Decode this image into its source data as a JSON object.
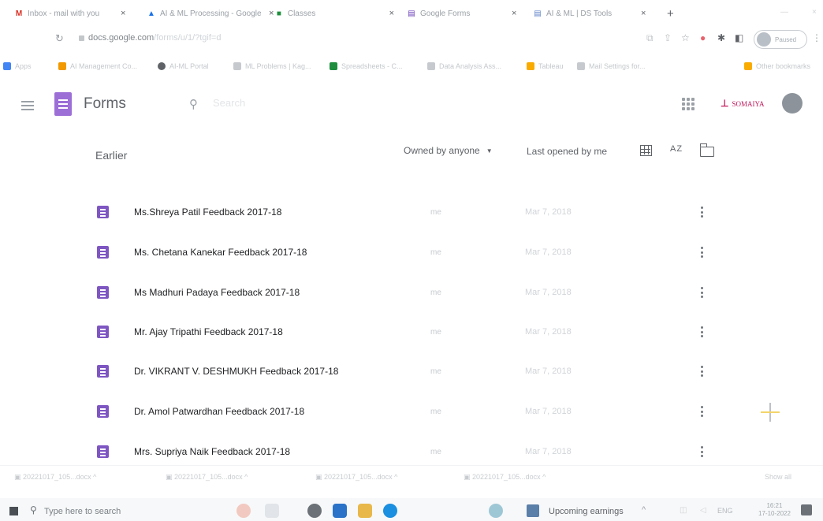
{
  "browser": {
    "tabs": [
      {
        "title": "Inbox - mail with you",
        "icon": "gmail-icon",
        "color": "#d93025"
      },
      {
        "title": "AI & ML Processing - Google",
        "icon": "drive-icon",
        "color": "#1a73e8"
      },
      {
        "title": "Classes",
        "icon": "classroom-icon",
        "color": "#1e8e3e"
      },
      {
        "title": "Google Forms",
        "icon": "forms-icon",
        "color": "#673ab7"
      },
      {
        "title": "AI & ML | DS Tools",
        "icon": "forms-icon",
        "color": "#5b7fc7"
      }
    ],
    "new_tab_label": "+",
    "url": {
      "domain": "docs.google.com",
      "path": "/forms/u/1/?tgif=d"
    },
    "profile_label": "Paused",
    "bookmarks": [
      {
        "label": "Apps",
        "color": "#4285f4"
      },
      {
        "label": "AI Management Co...",
        "color": "#f29900"
      },
      {
        "label": "AI-ML Portal",
        "color": "#5f6368"
      },
      {
        "label": "ML Problems | Kag...",
        "color": "#c6cacf"
      },
      {
        "label": "Spreadsheets - C...",
        "color": "#1e8e3e"
      },
      {
        "label": "Data Analysis Ass...",
        "color": "#c6cacf"
      },
      {
        "label": "Tableau",
        "color": "#f9ab00"
      },
      {
        "label": "Mail Settings for...",
        "color": "#c6cacf"
      },
      {
        "label": "Other bookmarks",
        "color": "#f9ab00"
      }
    ]
  },
  "header": {
    "app_title": "Forms",
    "search_placeholder": "Search",
    "org_label": "SOMAIYA"
  },
  "toolbar": {
    "section_label": "Earlier",
    "owner_filter": "Owned by anyone",
    "sort_label": "Last opened by me",
    "az_label": "AZ"
  },
  "files": [
    {
      "name": "Ms.Shreya Patil Feedback 2017-18",
      "owner": "me",
      "opened": "Mar 7, 2018"
    },
    {
      "name": "Ms. Chetana Kanekar Feedback 2017-18",
      "owner": "me",
      "opened": "Mar 7, 2018"
    },
    {
      "name": "Ms Madhuri Padaya Feedback 2017-18",
      "owner": "me",
      "opened": "Mar 7, 2018"
    },
    {
      "name": "Mr. Ajay Tripathi Feedback 2017-18",
      "owner": "me",
      "opened": "Mar 7, 2018"
    },
    {
      "name": "Dr. VIKRANT V. DESHMUKH Feedback 2017-18",
      "owner": "me",
      "opened": "Mar 7, 2018"
    },
    {
      "name": "Dr. Amol Patwardhan Feedback 2017-18",
      "owner": "me",
      "opened": "Mar 7, 2018"
    },
    {
      "name": "Mrs. Supriya Naik Feedback 2017-18",
      "owner": "me",
      "opened": "Mar 7, 2018"
    }
  ],
  "downloads": [
    {
      "label": "20221017_105...docx"
    },
    {
      "label": "20221017_105...docx"
    },
    {
      "label": "20221017_105...docx"
    },
    {
      "label": "20221017_105...docx"
    }
  ],
  "downloads_show_all": "Show all",
  "taskbar": {
    "search_placeholder": "Type here to search",
    "news_label": "Upcoming earnings",
    "language": "ENG",
    "time": "16:21",
    "date": "17-10-2022"
  }
}
